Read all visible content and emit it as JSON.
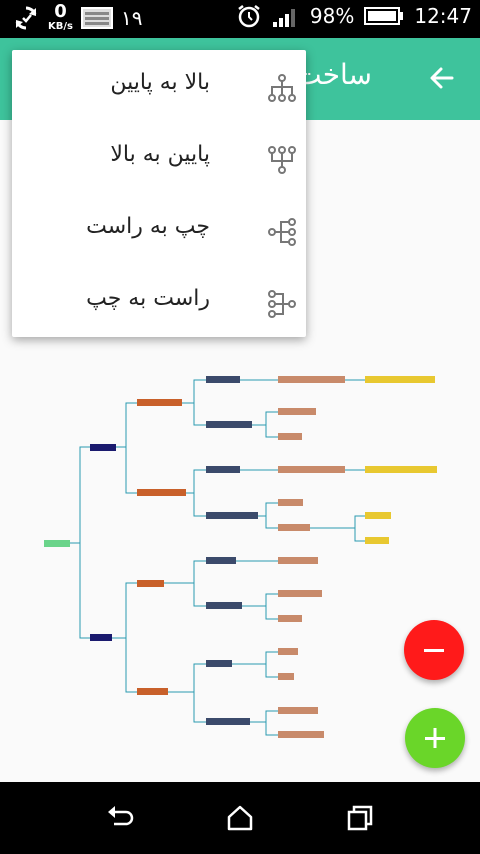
{
  "status_bar": {
    "net_speed_value": "0",
    "net_speed_unit": "KB/s",
    "notification_count": "۱۹",
    "battery_percent": "98%",
    "time": "12:47"
  },
  "app_bar": {
    "title": "ساخت"
  },
  "menu": {
    "items": [
      {
        "label": "بالا به پایین",
        "icon": "top-down-tree-icon"
      },
      {
        "label": "پایین به بالا",
        "icon": "bottom-up-tree-icon"
      },
      {
        "label": "چپ به راست",
        "icon": "left-right-tree-icon"
      },
      {
        "label": "راست به چپ",
        "icon": "right-left-tree-icon"
      }
    ]
  },
  "colors": {
    "app_bar": "#3ec39c",
    "fab_minus": "#ff1a1a",
    "fab_plus": "#6ad629",
    "node_root": "#6ad48a",
    "node_navy": "#1a1a6e",
    "node_orange": "#c8602a",
    "node_slate": "#3b4a6b",
    "node_peach": "#c88a6a",
    "node_yellow": "#e8c830",
    "connector": "#2a9ab0"
  }
}
